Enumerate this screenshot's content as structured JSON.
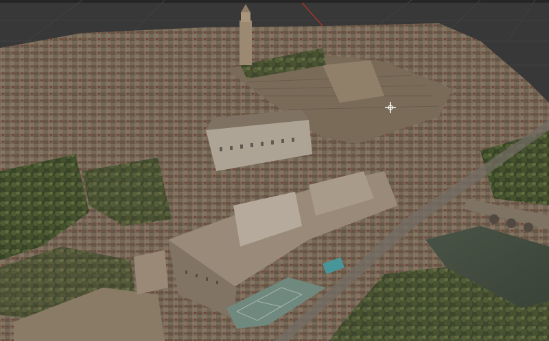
{
  "viewport": {
    "kind": "3d-viewport",
    "background": "#3d3d3d",
    "grid_color": "#4a4a4a",
    "axis_x_color": "#c0392b",
    "show_grid": true,
    "model": "photogrammetry-city-mesh"
  },
  "cursor": {
    "icon": "orbit-cursor-icon"
  }
}
